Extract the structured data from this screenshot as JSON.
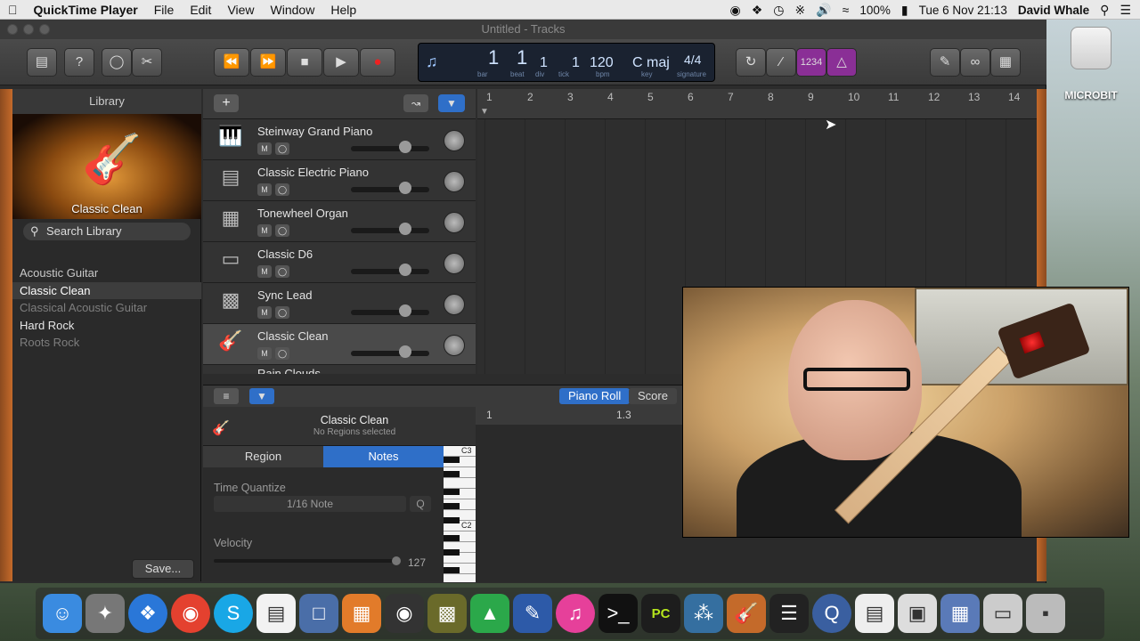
{
  "menubar": {
    "app": "QuickTime Player",
    "items": [
      "File",
      "Edit",
      "View",
      "Window",
      "Help"
    ],
    "battery": "100%",
    "datetime": "Tue 6 Nov  21:13",
    "user": "David Whale"
  },
  "desktop": {
    "drive_label": "MICROBIT"
  },
  "window": {
    "title": "Untitled - Tracks"
  },
  "lcd": {
    "bar": "1",
    "bar_label": "bar",
    "beat": "1",
    "beat_label": "beat",
    "div": "1",
    "div_label": "div",
    "tick": "1",
    "tick_label": "tick",
    "tempo": "120",
    "tempo_label": "bpm",
    "key": "C maj",
    "key_label": "key",
    "signature": "4/4",
    "signature_label": "signature",
    "count_in": "1234"
  },
  "library": {
    "header": "Library",
    "patch": "Classic Clean",
    "search_placeholder": "Search Library",
    "items": [
      "Acoustic Guitar",
      "Classic Clean",
      "Classical Acoustic Guitar",
      "Hard Rock",
      "Roots Rock"
    ],
    "save": "Save..."
  },
  "tracks": [
    {
      "name": "Steinway Grand Piano",
      "icon": "piano-icon"
    },
    {
      "name": "Classic Electric Piano",
      "icon": "electric-piano-icon"
    },
    {
      "name": "Tonewheel Organ",
      "icon": "organ-icon"
    },
    {
      "name": "Classic D6",
      "icon": "clavinet-icon"
    },
    {
      "name": "Sync Lead",
      "icon": "synth-icon"
    },
    {
      "name": "Classic Clean",
      "icon": "guitar-icon"
    },
    {
      "name": "Rain Clouds",
      "icon": "synth-icon"
    }
  ],
  "ruler": [
    "1",
    "2",
    "3",
    "4",
    "5",
    "6",
    "7",
    "8",
    "9",
    "10",
    "11",
    "12",
    "13",
    "14"
  ],
  "editor": {
    "track_name": "Classic Clean",
    "region_status": "No Regions selected",
    "tab_region": "Region",
    "tab_notes": "Notes",
    "tab_piano_roll": "Piano Roll",
    "tab_score": "Score",
    "quantize_label": "Time Quantize",
    "quantize_value": "1/16 Note",
    "quantize_btn": "Q",
    "velocity_label": "Velocity",
    "velocity_value": "127",
    "velocity_level": 127,
    "ruler_1": "1",
    "ruler_2": "1.3",
    "key_c3": "C3",
    "key_c2": "C2"
  },
  "dock": [
    "finder-icon",
    "launchpad-icon",
    "safari-icon",
    "chrome-icon",
    "skype-icon",
    "textedit-icon",
    "virtualbox-icon",
    "calculator-icon",
    "photo-icon",
    "gpu-icon",
    "cura-icon",
    "pen-icon",
    "itunes-icon",
    "terminal-icon",
    "pycharm-icon",
    "python-icon",
    "garageband-icon",
    "instrument-icon",
    "quicktime-icon",
    "documents-icon",
    "images-icon",
    "preview-icon",
    "window-icon",
    "trash-icon"
  ]
}
